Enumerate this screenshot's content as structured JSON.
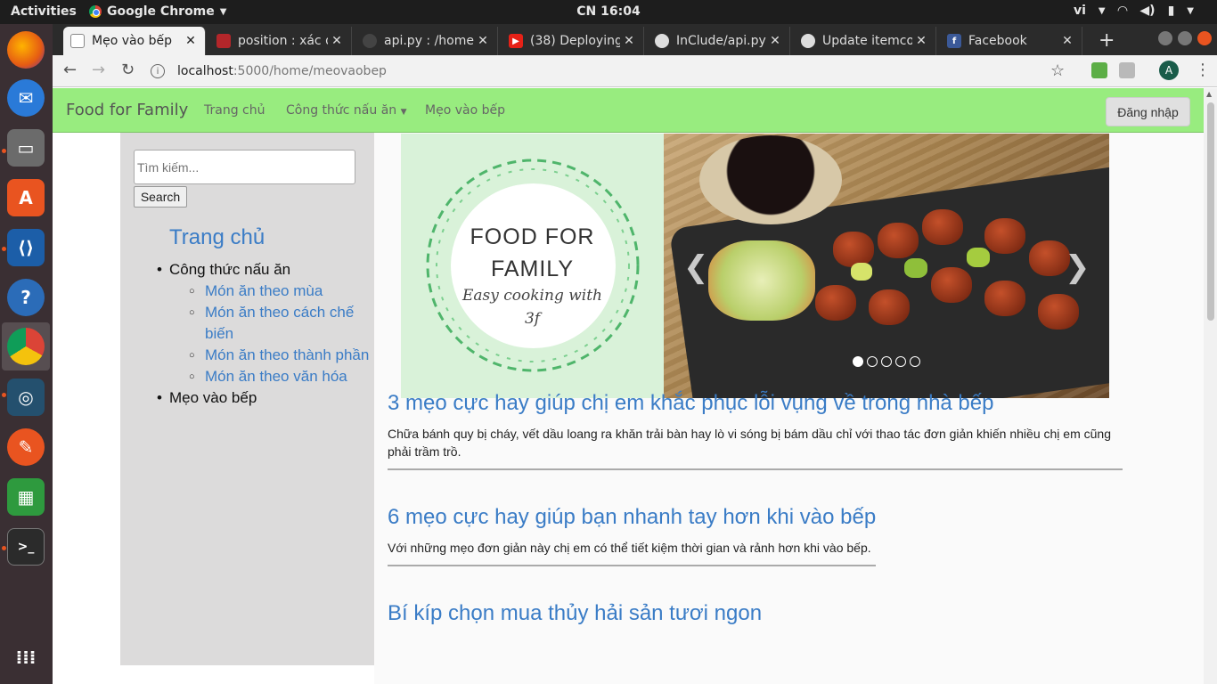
{
  "topbar": {
    "activities": "Activities",
    "app_name": "Google Chrome",
    "clock": "CN 16:04",
    "language": "vi"
  },
  "browser": {
    "tabs": [
      {
        "label": "Mẹo vào bếp",
        "active": true
      },
      {
        "label": "position : xác đ"
      },
      {
        "label": "api.py : /home/"
      },
      {
        "label": "(38) Deploying"
      },
      {
        "label": "InClude/api.py"
      },
      {
        "label": "Update itemco"
      },
      {
        "label": "Facebook"
      }
    ],
    "url_host": "localhost",
    "url_path": ":5000/home/meovaobep",
    "avatar_letter": "A"
  },
  "site": {
    "brand": "Food for Family",
    "nav": {
      "home": "Trang chủ",
      "recipes": "Công thức nấu ăn",
      "tips": "Mẹo vào bếp"
    },
    "login": "Đăng nhập"
  },
  "sidebar": {
    "search_placeholder": "Tìm kiếm...",
    "search_button": "Search",
    "home": "Trang chủ",
    "recipes": "Công thức nấu ăn",
    "sub": [
      "Món ăn theo mùa",
      "Món ăn theo cách chế biến",
      "Món ăn theo thành phần",
      "Món ăn theo văn hóa"
    ],
    "tips": "Mẹo vào bếp"
  },
  "carousel": {
    "logo_line1": "FOOD FOR",
    "logo_line2": "FAMILY",
    "logo_line3": "Easy cooking with",
    "logo_line4": "3f",
    "slide_count": 5,
    "active_index": 0
  },
  "articles": [
    {
      "title": "3 mẹo cực hay giúp chị em khắc phục lỗi vụng về trong nhà bếp",
      "desc": "Chữa bánh quy bị cháy, vết dầu loang ra khăn trải bàn hay lò vi sóng bị bám dầu chỉ với thao tác đơn giản khiến nhiều chị em cũng phải trầm trồ."
    },
    {
      "title": "6 mẹo cực hay giúp bạn nhanh tay hơn khi vào bếp",
      "desc": "Với những mẹo đơn giản này chị em có thể tiết kiệm thời gian và rảnh hơn khi vào bếp."
    },
    {
      "title": "Bí kíp chọn mua thủy hải sản tươi ngon",
      "desc": ""
    }
  ],
  "colors": {
    "navbar": "#98ec7f",
    "link": "#3a7cc6",
    "sidebar": "#dcdbdb",
    "ubuntu_accent": "#e95420"
  }
}
